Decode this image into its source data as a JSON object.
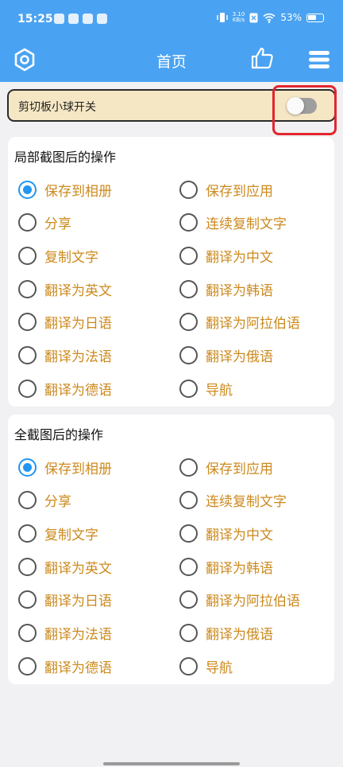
{
  "status_bar": {
    "time": "15:25",
    "net_speed_value": "3.10",
    "net_speed_unit": "KB/s",
    "battery": "53%"
  },
  "toolbar": {
    "title": "首页",
    "icons": [
      "settings-hexagon-icon",
      "thumbs-up-icon",
      "menu-icon"
    ]
  },
  "clipboard_switch": {
    "label": "剪切板小球开关",
    "enabled": false
  },
  "colors": {
    "header": "#4aa3f2",
    "option_text": "#cc8a1e",
    "radio_selected": "#2196f3",
    "highlight_box": "#e3262e"
  },
  "partial": {
    "heading": "局部截图后的操作",
    "options": [
      "保存到相册",
      "保存到应用",
      "分享",
      "连续复制文字",
      "复制文字",
      "翻译为中文",
      "翻译为英文",
      "翻译为韩语",
      "翻译为日语",
      "翻译为阿拉伯语",
      "翻译为法语",
      "翻译为俄语",
      "翻译为德语",
      "导航"
    ],
    "selected_index": 0
  },
  "full": {
    "heading": "全截图后的操作",
    "options": [
      "保存到相册",
      "保存到应用",
      "分享",
      "连续复制文字",
      "复制文字",
      "翻译为中文",
      "翻译为英文",
      "翻译为韩语",
      "翻译为日语",
      "翻译为阿拉伯语",
      "翻译为法语",
      "翻译为俄语",
      "翻译为德语",
      "导航"
    ],
    "selected_index": 0
  }
}
